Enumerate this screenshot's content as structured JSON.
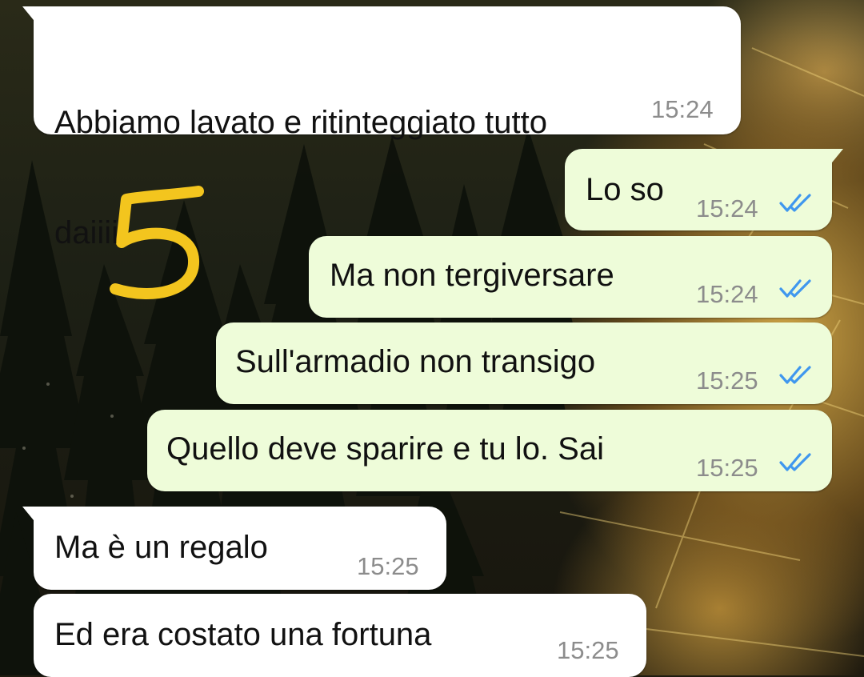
{
  "annotation": {
    "text": "5",
    "color": "#f3c51e"
  },
  "colors": {
    "incoming_bubble": "#ffffff",
    "outgoing_bubble": "#eefcd9",
    "timestamp": "#8c8c8c",
    "read_ticks": "#3f97ee"
  },
  "messages": [
    {
      "direction": "incoming",
      "lines": [
        "Abbiamo lavato e ritinteggiato tutto",
        "daiiii"
      ],
      "time": "15:24"
    },
    {
      "direction": "outgoing",
      "text": "Lo so",
      "time": "15:24",
      "status_icon": "double-check-read-icon"
    },
    {
      "direction": "outgoing",
      "text": "Ma non tergiversare",
      "time": "15:24",
      "status_icon": "double-check-read-icon"
    },
    {
      "direction": "outgoing",
      "text": "Sull'armadio non transigo",
      "time": "15:25",
      "status_icon": "double-check-read-icon"
    },
    {
      "direction": "outgoing",
      "text": "Quello deve sparire e tu lo. Sai",
      "time": "15:25",
      "status_icon": "double-check-read-icon"
    },
    {
      "direction": "incoming",
      "text": "Ma è un regalo",
      "time": "15:25"
    },
    {
      "direction": "incoming",
      "text": "Ed era costato una fortuna",
      "time": "15:25"
    }
  ]
}
